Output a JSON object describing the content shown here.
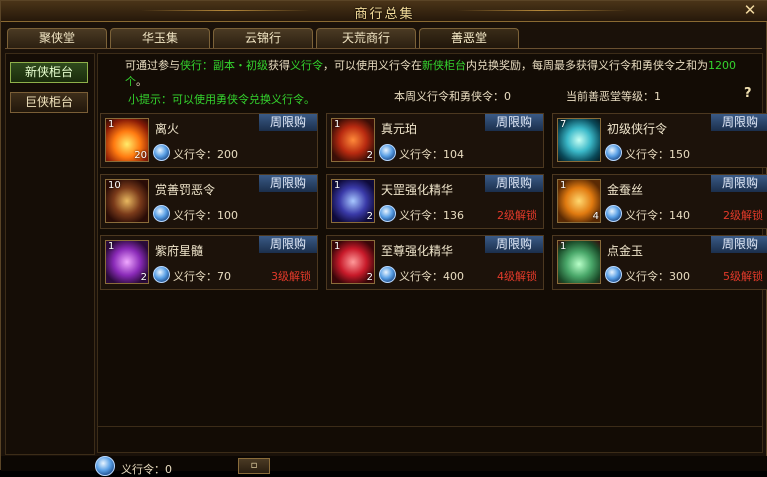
{
  "window": {
    "title": "商行总集",
    "close": "✕"
  },
  "tabs": [
    "聚侠堂",
    "华玉集",
    "云锦行",
    "天荒商行",
    "善恶堂"
  ],
  "sidebar": [
    "新侠柜台",
    "巨侠柜台"
  ],
  "info": {
    "p1": "可通过参与",
    "l1": "侠行：副本・初级",
    "p2": "获得",
    "l2": "义行令",
    "p3": "，可以使用义行令在",
    "l3": "新侠柜台",
    "p4": "内兑换奖励，每周最多获得义行令和勇侠令之和为",
    "l4": "1200个",
    "p5": "。",
    "tip": "小提示：可以使用勇侠令兑换义行令。",
    "weekly": "本周义行令和勇侠令：0",
    "level": "当前善恶堂等级：1",
    "help": "?"
  },
  "colors": {
    "accent_green": "#34d42e",
    "limit_badge": "#2a4670",
    "lock_red": "#e33a2a"
  },
  "items": [
    {
      "name": "离火",
      "tl": "1",
      "br": "20",
      "badge": "周限购",
      "currency": "义行令",
      "price": "200",
      "unlock": "",
      "icon": "fire-icon"
    },
    {
      "name": "真元珀",
      "tl": "1",
      "br": "2",
      "badge": "周限购",
      "currency": "义行令",
      "price": "104",
      "unlock": "",
      "icon": "amber-icon"
    },
    {
      "name": "初级侠行令",
      "tl": "7",
      "br": "",
      "badge": "周限购",
      "currency": "义行令",
      "price": "150",
      "unlock": "",
      "icon": "token-icon"
    },
    {
      "name": "赏善罚恶令",
      "tl": "10",
      "br": "",
      "badge": "周限购",
      "currency": "义行令",
      "price": "100",
      "unlock": "",
      "icon": "seal-icon"
    },
    {
      "name": "天罡强化精华",
      "tl": "1",
      "br": "2",
      "badge": "周限购",
      "currency": "义行令",
      "price": "136",
      "unlock": "2级解锁",
      "icon": "essence-icon"
    },
    {
      "name": "金蚕丝",
      "tl": "1",
      "br": "4",
      "badge": "周限购",
      "currency": "义行令",
      "price": "140",
      "unlock": "2级解锁",
      "icon": "silk-icon"
    },
    {
      "name": "紫府星髓",
      "tl": "1",
      "br": "2",
      "badge": "周限购",
      "currency": "义行令",
      "price": "70",
      "unlock": "3级解锁",
      "icon": "marrow-icon"
    },
    {
      "name": "至尊强化精华",
      "tl": "1",
      "br": "2",
      "badge": "周限购",
      "currency": "义行令",
      "price": "400",
      "unlock": "4级解锁",
      "icon": "supreme-essence-icon"
    },
    {
      "name": "点金玉",
      "tl": "1",
      "br": "",
      "badge": "周限购",
      "currency": "义行令",
      "price": "300",
      "unlock": "5级解锁",
      "icon": "jade-icon"
    }
  ],
  "footer": {
    "balance": "义行令：0",
    "button": "▫"
  }
}
